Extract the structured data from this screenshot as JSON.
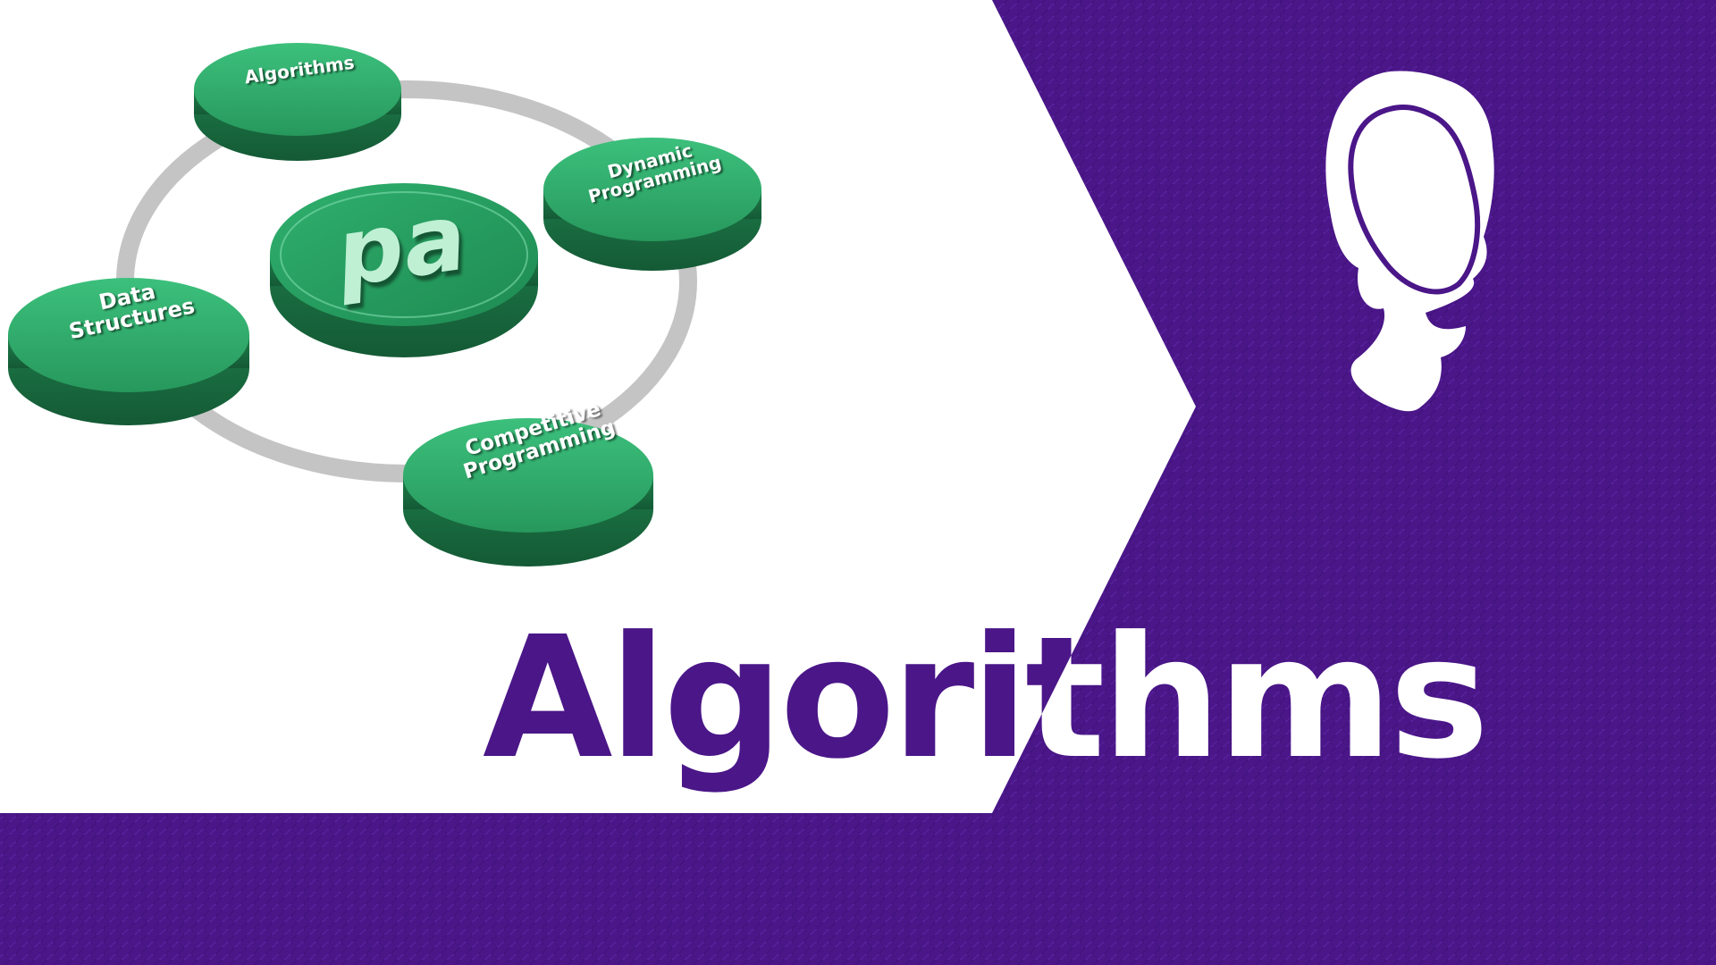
{
  "colors": {
    "purple": "#4a1688",
    "purple_light": "#6a2bb0",
    "white": "#ffffff",
    "disk_green": "#2eaa6a",
    "disk_green_dark": "#1f7f4c",
    "ring_gray": "#c8c8c8"
  },
  "diagram": {
    "center_logo": "pa",
    "nodes": [
      {
        "label_lines": [
          "Algorithms"
        ]
      },
      {
        "label_lines": [
          "Dynamic",
          "Programming"
        ]
      },
      {
        "label_lines": [
          "Data",
          "Structures"
        ]
      },
      {
        "label_lines": [
          "Competitive",
          "Programming"
        ]
      }
    ]
  },
  "headline": "Algorithms",
  "icons": {
    "thinker": "thinking-person-icon"
  }
}
